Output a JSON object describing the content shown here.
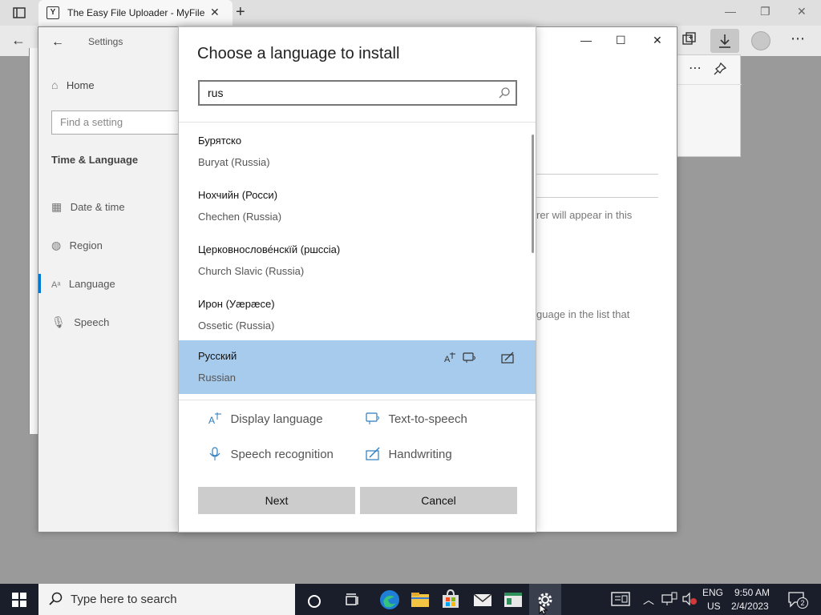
{
  "browser": {
    "tab_title": "The Easy File Uploader - MyFile",
    "favicon_letter": "Y"
  },
  "settings": {
    "title": "Settings",
    "home": "Home",
    "search_placeholder": "Find a setting",
    "section": "Time & Language",
    "nav": [
      {
        "label": "Date & time",
        "icon": "calendar-clock-icon"
      },
      {
        "label": "Region",
        "icon": "globe-icon"
      },
      {
        "label": "Language",
        "icon": "language-icon"
      },
      {
        "label": "Speech",
        "icon": "microphone-icon"
      }
    ],
    "bg_text_1": "rer will appear in this",
    "bg_text_2": "guage in the list that"
  },
  "dialog": {
    "title": "Choose a language to install",
    "search_value": "rus",
    "languages": [
      {
        "native": "Бурятско",
        "english": "Buryat (Russia)"
      },
      {
        "native": "Нохчийн (Росси)",
        "english": "Chechen (Russia)"
      },
      {
        "native": "Церковнослове́нскїй (ршссіа)",
        "english": "Church Slavic (Russia)"
      },
      {
        "native": "Ирон (Уæрæсе)",
        "english": "Ossetic (Russia)"
      },
      {
        "native": "Русский",
        "english": "Russian",
        "selected": true
      }
    ],
    "features": {
      "display_language": "Display language",
      "text_to_speech": "Text-to-speech",
      "speech_recognition": "Speech recognition",
      "handwriting": "Handwriting"
    },
    "next_label": "Next",
    "cancel_label": "Cancel"
  },
  "taskbar": {
    "search_placeholder": "Type here to search",
    "lang_line1": "ENG",
    "lang_line2": "US",
    "time": "9:50 AM",
    "date": "2/4/2023",
    "notification_count": "2"
  },
  "colors": {
    "selected_row": "#a7cbec",
    "accent": "#0078d4",
    "taskbar": "#1a1e2b"
  }
}
